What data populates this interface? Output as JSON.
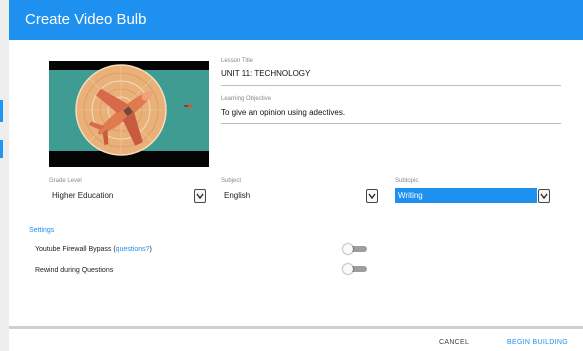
{
  "dialog": {
    "title": "Create Video Bulb"
  },
  "lesson_title": {
    "label": "Lesson Title",
    "value": "UNIT 11: TECHNOLOGY"
  },
  "learning_objective": {
    "label": "Learning Objective",
    "value": "To give an opinion using adectives."
  },
  "grade_level": {
    "label": "Grade Level",
    "value": "Higher Education"
  },
  "subject": {
    "label": "Subject",
    "value": "English"
  },
  "subtopic": {
    "label": "Subtopic",
    "value": "Writing"
  },
  "settings": {
    "title": "Settings",
    "youtube_bypass": {
      "label": "Youtube Firewall Bypass (",
      "link": "questions?",
      "suffix": ")",
      "enabled": false
    },
    "rewind": {
      "label": "Rewind during Questions",
      "enabled": false
    }
  },
  "footer": {
    "cancel": "CANCEL",
    "begin": "BEGIN BUILDING"
  },
  "colors": {
    "accent": "#1e90ef",
    "selected_bg": "#1e90ef"
  },
  "icons": {
    "thumbnail": "airplane-illustration",
    "dropdown": "chevron-down-icon"
  }
}
